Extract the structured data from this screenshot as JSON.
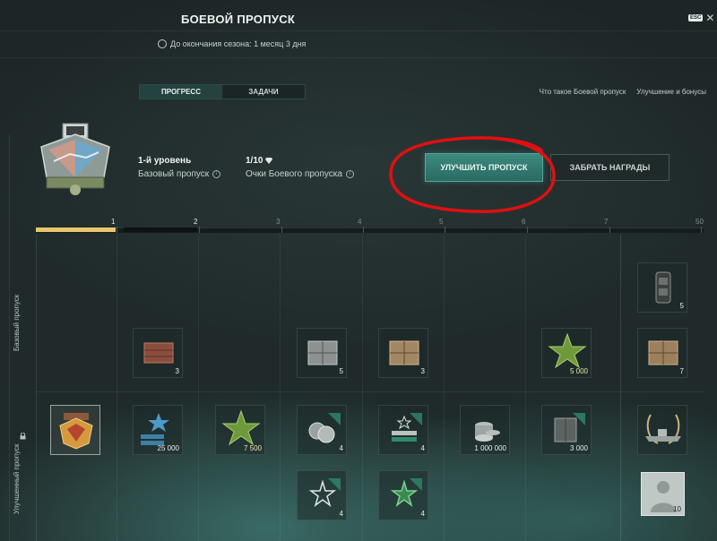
{
  "header": {
    "title": "БОЕВОЙ ПРОПУСК",
    "season_text": "До окончания сезона: 1 месяц 3 дня",
    "esc_label": "ESC",
    "close_symbol": "✕"
  },
  "tabs": [
    {
      "label": "ПРОГРЕСС",
      "active": true
    },
    {
      "label": "ЗАДАЧИ",
      "active": false
    }
  ],
  "links": {
    "what_is": "Что такое Боевой пропуск",
    "upgrade_bonuses": "Улучшение и бонусы"
  },
  "level": {
    "title": "1-й уровень",
    "pass_type": "Базовый пропуск"
  },
  "points": {
    "value": "1/10",
    "label": "Очки Боевого пропуска"
  },
  "buttons": {
    "upgrade": "УЛУЧШИТЬ ПРОПУСК",
    "claim": "ЗАБРАТЬ НАГРАДЫ"
  },
  "progress": {
    "current_level": 1,
    "fill_fraction": 0.12,
    "ticks": [
      "1",
      "2",
      "3",
      "4",
      "5",
      "6",
      "7",
      "50"
    ]
  },
  "rows": {
    "basic": "Базовый пропуск",
    "premium": "Улучшенный пропуск"
  },
  "rewards": {
    "basic": [
      {
        "icon": "container-icon",
        "qty": "3"
      },
      {
        "icon": "container-icon",
        "qty": "5"
      },
      {
        "icon": "container-icon",
        "qty": "3"
      },
      {
        "icon": "star-icon",
        "qty": "5 000"
      },
      {
        "icon": "camouflage-icon",
        "qty": "5"
      },
      {
        "icon": "container-icon",
        "qty": "7"
      }
    ],
    "premium": [
      {
        "icon": "patch-icon",
        "qty": ""
      },
      {
        "icon": "star-icon",
        "qty": "25 000"
      },
      {
        "icon": "star-icon",
        "qty": "7 500"
      },
      {
        "icon": "coins-icon",
        "qty": "4"
      },
      {
        "icon": "flags-icon",
        "qty": "4"
      },
      {
        "icon": "credits-icon",
        "qty": "1 000 000"
      },
      {
        "icon": "ship-container-icon",
        "qty": "3 000"
      },
      {
        "icon": "ship-icon",
        "qty": ""
      },
      {
        "icon": "star-icon",
        "qty": "4"
      },
      {
        "icon": "star-icon",
        "qty": "4"
      },
      {
        "icon": "commander-icon",
        "qty": "10"
      }
    ]
  },
  "colors": {
    "accent": "#3c8a80",
    "progress_fill": "#e8c76a",
    "annotation": "#e01010"
  }
}
